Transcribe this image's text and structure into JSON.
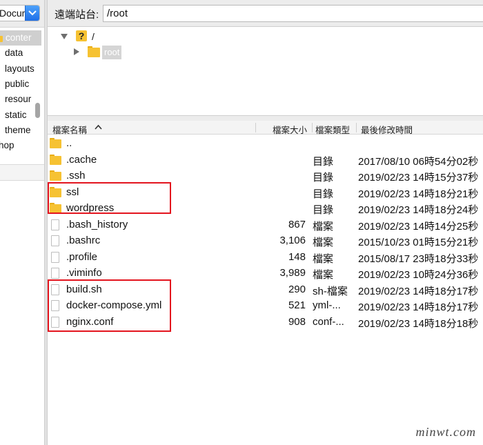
{
  "local": {
    "site_select_value": "Docum",
    "tree_items": [
      "conter",
      "data",
      "layouts",
      "public",
      "resour",
      "static",
      "theme",
      "hop"
    ],
    "selected_item_index": 0
  },
  "remote": {
    "site_label": "遠端站台:",
    "path": "/root",
    "tree": {
      "root_label": "/",
      "child_label": "root"
    }
  },
  "columns": {
    "name": "檔案名稱",
    "size": "檔案大小",
    "type": "檔案類型",
    "modified": "最後修改時間"
  },
  "files": [
    {
      "name": "..",
      "size": "",
      "type": "",
      "modified": "",
      "icon": "folder-icon"
    },
    {
      "name": ".cache",
      "size": "",
      "type": "目錄",
      "modified": "2017/08/10 06時54分02秒",
      "icon": "folder-icon"
    },
    {
      "name": ".ssh",
      "size": "",
      "type": "目錄",
      "modified": "2019/02/23 14時15分37秒",
      "icon": "folder-icon"
    },
    {
      "name": "ssl",
      "size": "",
      "type": "目錄",
      "modified": "2019/02/23 14時18分21秒",
      "icon": "folder-icon"
    },
    {
      "name": "wordpress",
      "size": "",
      "type": "目錄",
      "modified": "2019/02/23 14時18分24秒",
      "icon": "folder-icon"
    },
    {
      "name": ".bash_history",
      "size": "867",
      "type": "檔案",
      "modified": "2019/02/23 14時14分25秒",
      "icon": "file-icon"
    },
    {
      "name": ".bashrc",
      "size": "3,106",
      "type": "檔案",
      "modified": "2015/10/23 01時15分21秒",
      "icon": "file-icon"
    },
    {
      "name": ".profile",
      "size": "148",
      "type": "檔案",
      "modified": "2015/08/17 23時18分33秒",
      "icon": "file-icon"
    },
    {
      "name": ".viminfo",
      "size": "3,989",
      "type": "檔案",
      "modified": "2019/02/23 10時24分36秒",
      "icon": "file-icon"
    },
    {
      "name": "build.sh",
      "size": "290",
      "type": "sh-檔案",
      "modified": "2019/02/23 14時18分17秒",
      "icon": "file-icon"
    },
    {
      "name": "docker-compose.yml",
      "size": "521",
      "type": "yml-...",
      "modified": "2019/02/23 14時18分17秒",
      "icon": "file-icon"
    },
    {
      "name": "nginx.conf",
      "size": "908",
      "type": "conf-...",
      "modified": "2019/02/23 14時18分18秒",
      "icon": "file-icon"
    }
  ],
  "colors": {
    "highlight": "#e3131d",
    "folder": "#f6c232",
    "select_button": "#2f80f0"
  },
  "watermark": "minwt.com"
}
